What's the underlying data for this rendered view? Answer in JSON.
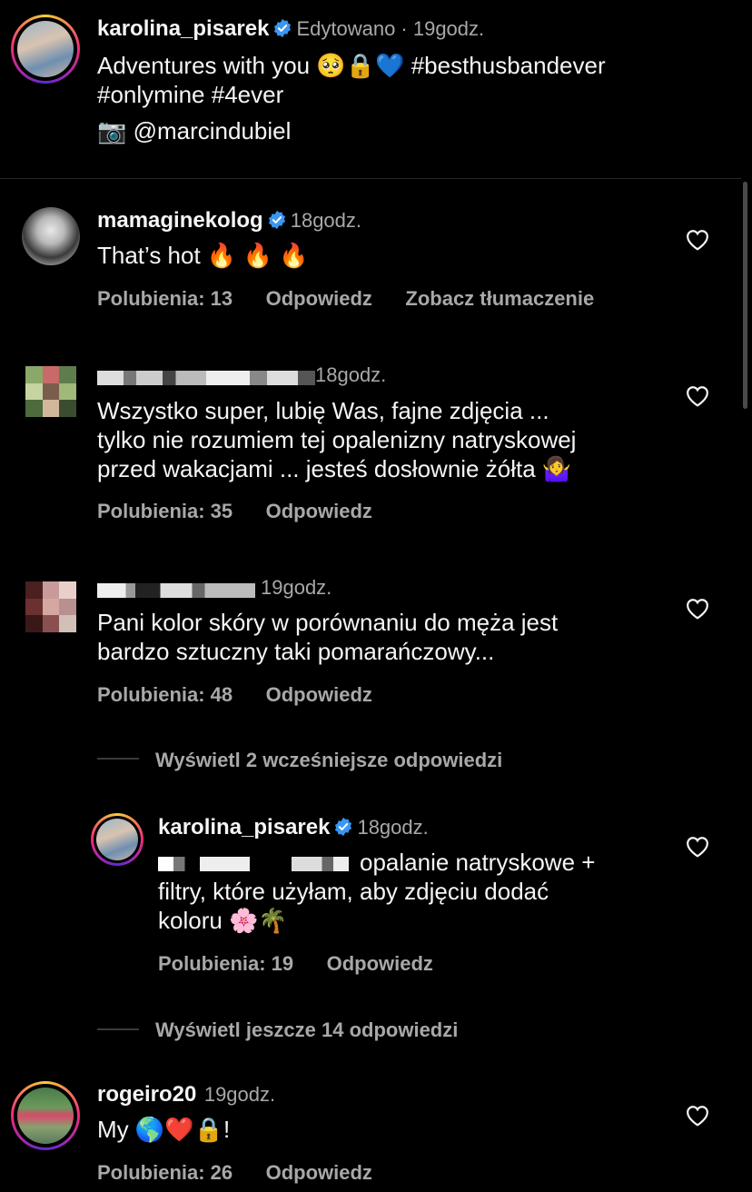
{
  "post": {
    "username": "karolina_pisarek",
    "meta": "Edytowano · 19godz.",
    "caption_line1": "Adventures with you 🥺🔒💙 #besthusbandever",
    "caption_line2": "#onlymine #4ever",
    "photo_credit": "📷 @marcindubiel"
  },
  "comments": [
    {
      "username": "mamaginekolog",
      "time": "18godz.",
      "text": "That’s hot 🔥 🔥 🔥",
      "likes": "Polubienia: 13",
      "reply": "Odpowiedz",
      "translate": "Zobacz tłumaczenie"
    },
    {
      "time": "18godz.",
      "text_lines": [
        "Wszystko super, lubię Was, fajne zdjęcia ...",
        "tylko nie rozumiem tej opalenizny natryskowej",
        "przed wakacjami ... jesteś dosłownie żółta 🤷‍♀️"
      ],
      "likes": "Polubienia: 35",
      "reply": "Odpowiedz"
    },
    {
      "time": "19godz.",
      "text_lines": [
        "Pani kolor skóry w porównaniu do męża jest",
        "bardzo sztuczny taki pomarańczowy..."
      ],
      "likes": "Polubienia: 48",
      "reply": "Odpowiedz"
    }
  ],
  "view_earlier_replies": "Wyświetl 2 wcześniejsze odpowiedzi",
  "reply": {
    "username": "karolina_pisarek",
    "time": "18godz.",
    "text_line1": "opalanie natryskowe +",
    "text_line2": "filtry, które użyłam, aby zdjęciu dodać",
    "text_line3": "koloru 🌸🌴",
    "likes": "Polubienia: 19",
    "reply": "Odpowiedz"
  },
  "view_more_replies": "Wyświetl jeszcze 14 odpowiedzi",
  "last_comment": {
    "username": "rogeiro20",
    "time": "19godz.",
    "text": "My 🌎❤️🔒!",
    "likes": "Polubienia: 26",
    "reply": "Odpowiedz"
  },
  "colors": {
    "background": "#000000",
    "text": "#f5f5f5",
    "secondary": "#a8a8a8",
    "verified": "#3897f0"
  },
  "icons": [
    "verified-badge-icon",
    "heart-icon"
  ]
}
